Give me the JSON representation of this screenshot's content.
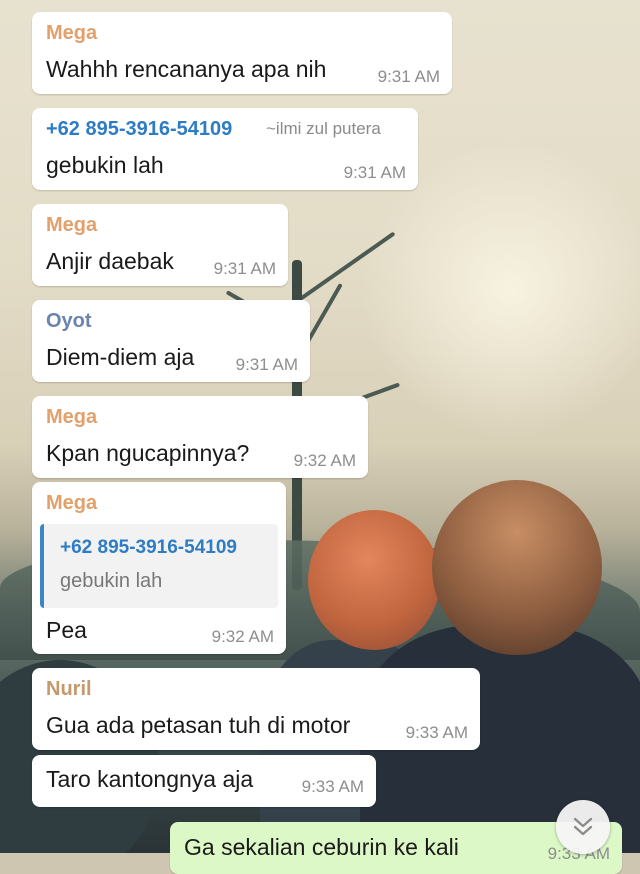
{
  "colors": {
    "mega": "#e3a06a",
    "phone": "#2e7cc4",
    "oyot": "#6b83ad",
    "nuril": "#c49a6c"
  },
  "messages": [
    {
      "sender": "Mega",
      "text": "Wahhh rencananya apa nih",
      "time": "9:31 AM"
    },
    {
      "sender": "+62 895-3916-54109",
      "sender_alt": "~ilmi zul putera",
      "text": "gebukin lah",
      "time": "9:31 AM"
    },
    {
      "sender": "Mega",
      "text": "Anjir daebak",
      "time": "9:31 AM"
    },
    {
      "sender": "Oyot",
      "text": "Diem-diem aja",
      "time": "9:31 AM"
    },
    {
      "sender": "Mega",
      "text": "Kpan ngucapinnya?",
      "time": "9:32 AM"
    },
    {
      "sender": "Mega",
      "quote_sender": "+62 895-3916-54109",
      "quote_text": "gebukin lah",
      "text": "Pea",
      "time": "9:32 AM"
    },
    {
      "sender": "Nuril",
      "text": "Gua ada petasan tuh di motor",
      "time": "9:33 AM"
    },
    {
      "text": "Taro kantongnya aja",
      "time": "9:33 AM"
    },
    {
      "text": "Ga sekalian ceburin ke kali",
      "time": "9:33 AM"
    }
  ],
  "scroll_button": {
    "icon": "double-chevron-down-icon"
  }
}
